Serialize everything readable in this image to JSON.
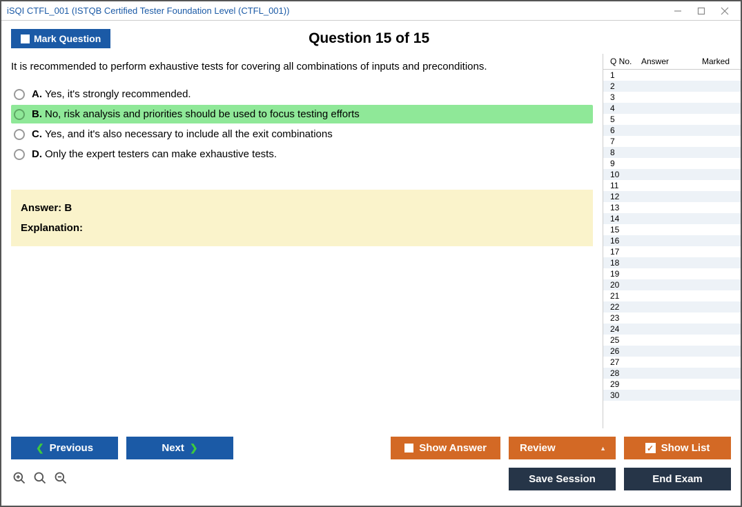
{
  "window": {
    "title": "iSQI CTFL_001 (ISTQB Certified Tester Foundation Level (CTFL_001))"
  },
  "header": {
    "mark_label": "Mark Question",
    "question_title": "Question 15 of 15"
  },
  "question": {
    "text": "It is recommended to perform exhaustive tests for covering all combinations of inputs and preconditions.",
    "choices": [
      {
        "letter": "A.",
        "text": "Yes, it's strongly recommended.",
        "correct": false
      },
      {
        "letter": "B.",
        "text": "No, risk analysis and priorities should be used to focus testing efforts",
        "correct": true
      },
      {
        "letter": "C.",
        "text": "Yes, and it's also necessary to include all the exit combinations",
        "correct": false
      },
      {
        "letter": "D.",
        "text": "Only the expert testers can make exhaustive tests.",
        "correct": false
      }
    ],
    "answer_label": "Answer:",
    "answer_value": "B",
    "explanation_label": "Explanation:",
    "explanation_text": ""
  },
  "sidebar": {
    "col_qno": "Q No.",
    "col_answer": "Answer",
    "col_marked": "Marked",
    "rows": [
      1,
      2,
      3,
      4,
      5,
      6,
      7,
      8,
      9,
      10,
      11,
      12,
      13,
      14,
      15,
      16,
      17,
      18,
      19,
      20,
      21,
      22,
      23,
      24,
      25,
      26,
      27,
      28,
      29,
      30
    ]
  },
  "footer": {
    "previous": "Previous",
    "next": "Next",
    "show_answer": "Show Answer",
    "review": "Review",
    "show_list": "Show List",
    "save_session": "Save Session",
    "end_exam": "End Exam"
  }
}
